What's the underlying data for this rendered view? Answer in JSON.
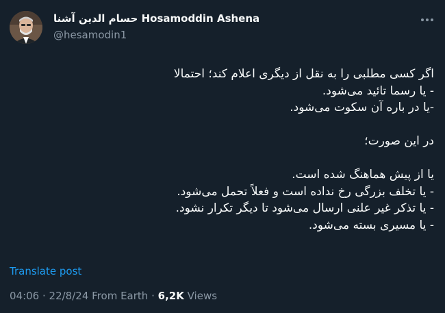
{
  "author": {
    "display_name": "حسام الدین آشنا Hosamoddin Ashena",
    "handle": "@hesamodin1"
  },
  "tweet": {
    "lines": [
      "اگر کسی مطلبی را به نقل از دیگری اعلام کند؛ احتمالا",
      "- یا رسما تائید می‌شود.",
      "-یا در باره آن سکوت می‌شود.",
      "",
      "در این صورت؛",
      "",
      "یا از پیش هماهنگ شده است.",
      "- یا تخلف بزرگی رخ نداده است و فعلاً تحمل می‌شود.",
      "- یا تذکر غیر علنی ارسال می‌شود تا دیگر تکرار نشود.",
      "- یا مسیری بسته می‌شود."
    ]
  },
  "translate_label": "Translate post",
  "meta": {
    "timestamp": "04:06 · 22/8/24",
    "source": "From Earth",
    "separator": "·",
    "views_count": "6,2K",
    "views_label": "Views"
  },
  "icons": {
    "more": "more-horizontal-icon",
    "avatar": "profile-photo"
  },
  "colors": {
    "background": "#15202b",
    "text_primary": "#f7f9f9",
    "text_secondary": "#8b98a5",
    "link": "#1d9bf0"
  }
}
